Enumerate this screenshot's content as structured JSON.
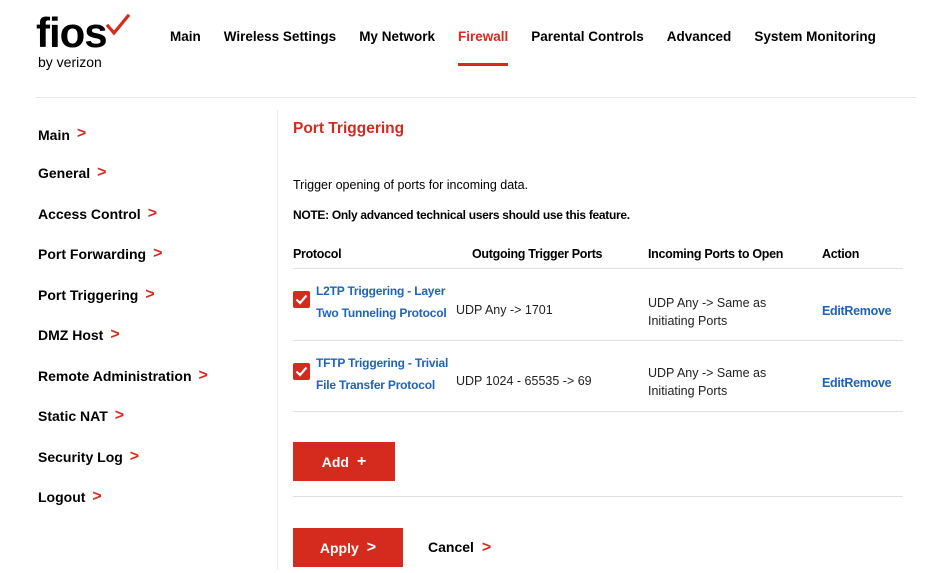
{
  "brand": {
    "logo_word": "fios",
    "logo_sub": "by verizon",
    "accent_color": "#d52b1e",
    "link_color": "#1e63b8"
  },
  "topnav": {
    "items": [
      {
        "label": "Main"
      },
      {
        "label": "Wireless Settings"
      },
      {
        "label": "My Network"
      },
      {
        "label": "Firewall",
        "active": true
      },
      {
        "label": "Parental Controls"
      },
      {
        "label": "Advanced"
      },
      {
        "label": "System Monitoring"
      }
    ]
  },
  "sidebar": {
    "chevron": ">",
    "items": [
      {
        "label": "Main"
      },
      {
        "label": "General"
      },
      {
        "label": "Access Control"
      },
      {
        "label": "Port Forwarding"
      },
      {
        "label": "Port Triggering"
      },
      {
        "label": "DMZ Host"
      },
      {
        "label": "Remote Administration"
      },
      {
        "label": "Static NAT"
      },
      {
        "label": "Security Log"
      },
      {
        "label": "Logout"
      }
    ]
  },
  "main": {
    "title": "Port Triggering",
    "description": "Trigger opening of ports for incoming data.",
    "note": "NOTE: Only advanced technical users should use this feature.",
    "columns": {
      "protocol": "Protocol",
      "outgoing": "Outgoing Trigger Ports",
      "incoming": "Incoming Ports to Open",
      "action": "Action"
    },
    "rows": [
      {
        "checked": true,
        "protocol_line1": "L2TP Triggering - Layer",
        "protocol_line2": "Two Tunneling Protocol",
        "outgoing": "UDP Any -> 1701",
        "incoming_line1": "UDP Any -> Same as",
        "incoming_line2": "Initiating Ports",
        "edit": "Edit",
        "remove": "Remove"
      },
      {
        "checked": true,
        "protocol_line1": "TFTP Triggering - Trivial",
        "protocol_line2": "File Transfer Protocol",
        "outgoing": "UDP 1024 - 65535 -> 69",
        "incoming_line1": "UDP Any -> Same as",
        "incoming_line2": "Initiating Ports",
        "edit": "Edit",
        "remove": "Remove"
      }
    ],
    "add_label": "Add",
    "add_symbol": "+",
    "apply_label": "Apply",
    "apply_symbol": ">",
    "cancel_label": "Cancel",
    "cancel_symbol": ">"
  }
}
